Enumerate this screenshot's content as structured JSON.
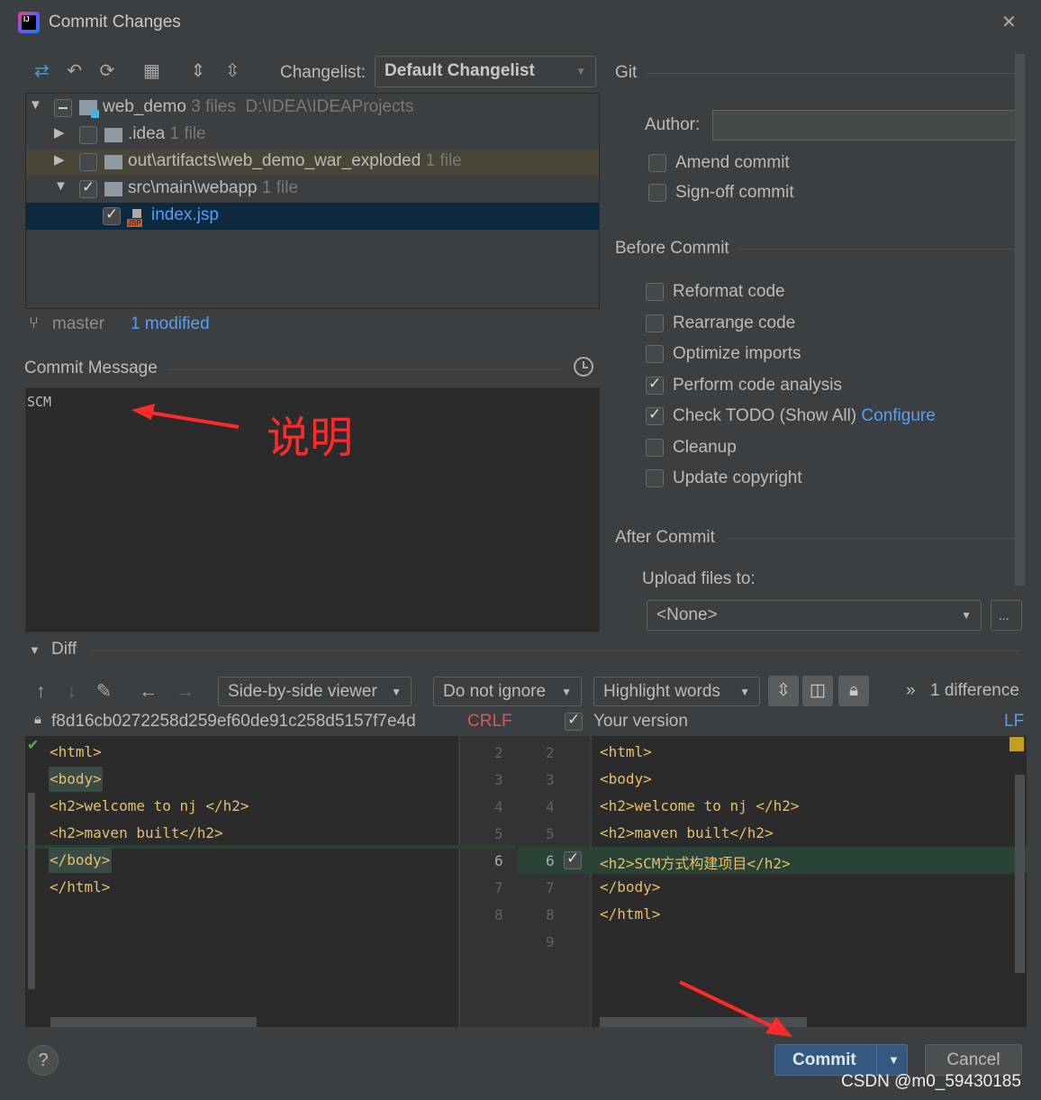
{
  "window": {
    "title": "Commit Changes",
    "close": "✕"
  },
  "toolbar": {
    "changelist_label": "Changelist:",
    "changelist_value": "Default Changelist"
  },
  "tree": [
    {
      "name": "web_demo",
      "meta": "3 files",
      "path": "D:\\IDEA\\IDEAProjects",
      "state": "partial",
      "expanded": true
    },
    {
      "name": ".idea",
      "meta": "1 file",
      "state": "off",
      "expanded": false
    },
    {
      "name": "out\\artifacts\\web_demo_war_exploded",
      "meta": "1 file",
      "state": "off",
      "expanded": false
    },
    {
      "name": "src\\main\\webapp",
      "meta": "1 file",
      "state": "on",
      "expanded": true
    },
    {
      "name": "index.jsp",
      "state": "on"
    }
  ],
  "status": {
    "branch": "master",
    "modified": "1 modified"
  },
  "commit_message": {
    "label": "Commit Message",
    "value": "SCM",
    "annotation": "说明"
  },
  "git": {
    "section": "Git",
    "author_label": "Author:",
    "author_value": "",
    "amend": "Amend commit",
    "signoff": "Sign-off commit"
  },
  "before_commit": {
    "section": "Before Commit",
    "options": [
      {
        "label": "Reformat code",
        "checked": false
      },
      {
        "label": "Rearrange code",
        "checked": false
      },
      {
        "label": "Optimize imports",
        "checked": false
      },
      {
        "label": "Perform code analysis",
        "checked": true
      },
      {
        "label": "Check TODO (Show All)",
        "checked": true,
        "link": "Configure"
      },
      {
        "label": "Cleanup",
        "checked": false
      },
      {
        "label": "Update copyright",
        "checked": false
      }
    ]
  },
  "after_commit": {
    "section": "After Commit",
    "upload_label": "Upload files to:",
    "upload_value": "<None>",
    "more": "..."
  },
  "diff": {
    "section": "Diff",
    "viewer": "Side-by-side viewer",
    "ignore": "Do not ignore",
    "highlight": "Highlight words",
    "count": "1 difference",
    "left_hash": "f8d16cb0272258d259ef60de91c258d5157f7e4d",
    "left_eol": "CRLF",
    "right_title": "Your version",
    "right_eol": "LF",
    "left_lines": [
      "<html>",
      "<body>",
      "<h2>welcome to nj </h2>",
      "<h2>maven built</h2>",
      "</body>",
      "</html>"
    ],
    "left_nums": [
      "2",
      "3",
      "4",
      "5",
      "6",
      "7",
      "8"
    ],
    "right_nums": [
      "2",
      "3",
      "4",
      "5",
      "6",
      "7",
      "8",
      "9"
    ],
    "right_lines": [
      "<html>",
      "<body>",
      "<h2>welcome to nj </h2>",
      "<h2>maven built</h2>",
      "<h2>SCM方式构建项目</h2>",
      "</body>",
      "</html>"
    ]
  },
  "buttons": {
    "help": "?",
    "commit": "Commit",
    "cancel": "Cancel"
  },
  "watermark": "CSDN @m0_59430185",
  "colors": {
    "accent": "#589df6",
    "selection": "#0d293e",
    "changed_row": "#294436",
    "annotation": "#ff2a2a"
  }
}
